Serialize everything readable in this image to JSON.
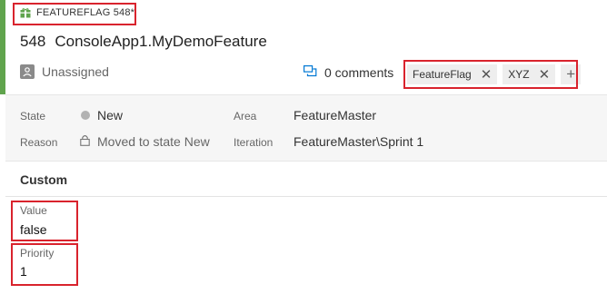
{
  "header": {
    "work_item_type": "FEATUREFLAG 548*",
    "id": "548",
    "title": "ConsoleApp1.MyDemoFeature",
    "assignee": "Unassigned",
    "comments": "0 comments",
    "tags": [
      "FeatureFlag",
      "XYZ"
    ]
  },
  "details": {
    "state_label": "State",
    "state_value": "New",
    "reason_label": "Reason",
    "reason_value": "Moved to state New",
    "area_label": "Area",
    "area_value": "FeatureMaster",
    "iteration_label": "Iteration",
    "iteration_value": "FeatureMaster\\Sprint 1"
  },
  "custom": {
    "section_title": "Custom",
    "fields": [
      {
        "label": "Value",
        "value": "false"
      },
      {
        "label": "Priority",
        "value": "1"
      }
    ]
  },
  "icons": {
    "type_icon": "gift-icon",
    "assignee_icon": "person-avatar-icon",
    "comments_icon": "comments-icon",
    "reason_icon": "lock-icon",
    "tag_remove_icon": "close-icon",
    "tag_add_icon": "plus-icon"
  },
  "colors": {
    "accent": "#60a44d",
    "highlight_box": "#d9232d",
    "link_blue": "#0078d4"
  }
}
